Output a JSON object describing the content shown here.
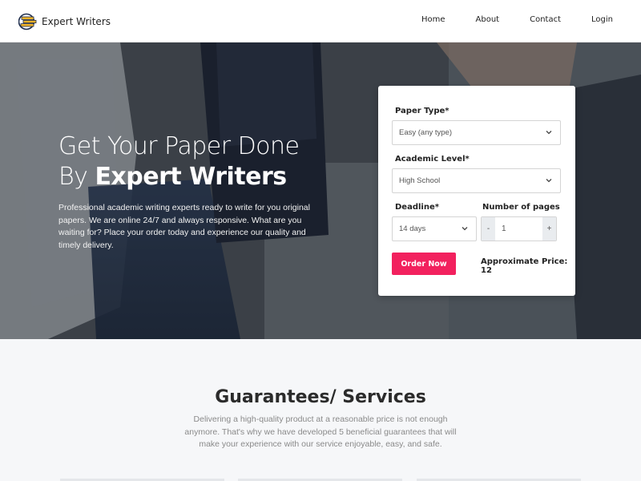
{
  "header": {
    "brand": "Expert Writers",
    "nav": [
      {
        "label": "Home"
      },
      {
        "label": "About"
      },
      {
        "label": "Contact"
      },
      {
        "label": "Login"
      }
    ]
  },
  "hero": {
    "title_line1": "Get Your Paper Done",
    "title_line2_prefix": "By ",
    "title_line2_strong": "Expert Writers",
    "description": "Professional academic writing experts ready to write for you original papers. We are online 24/7 and always responsive. What are you waiting for? Place your order today and experience our quality and timely delivery."
  },
  "order_form": {
    "paper_type_label": "Paper Type*",
    "paper_type_value": "Easy (any type)",
    "academic_level_label": "Academic Level*",
    "academic_level_value": "High School",
    "deadline_label": "Deadline*",
    "deadline_value": "14 days",
    "pages_label": "Number of pages",
    "pages_minus": "-",
    "pages_value": "1",
    "pages_plus": "+",
    "order_button": "Order Now",
    "price_text": "Approximate Price: 12"
  },
  "guarantees": {
    "title": "Guarantees/ Services",
    "description": "Delivering a high-quality product at a reasonable price is not enough anymore. That's why we have developed 5 beneficial guarantees that will make your experience with our service enjoyable, easy, and safe."
  },
  "colors": {
    "accent": "#f2215e",
    "brand_icon": "#f0b229"
  }
}
